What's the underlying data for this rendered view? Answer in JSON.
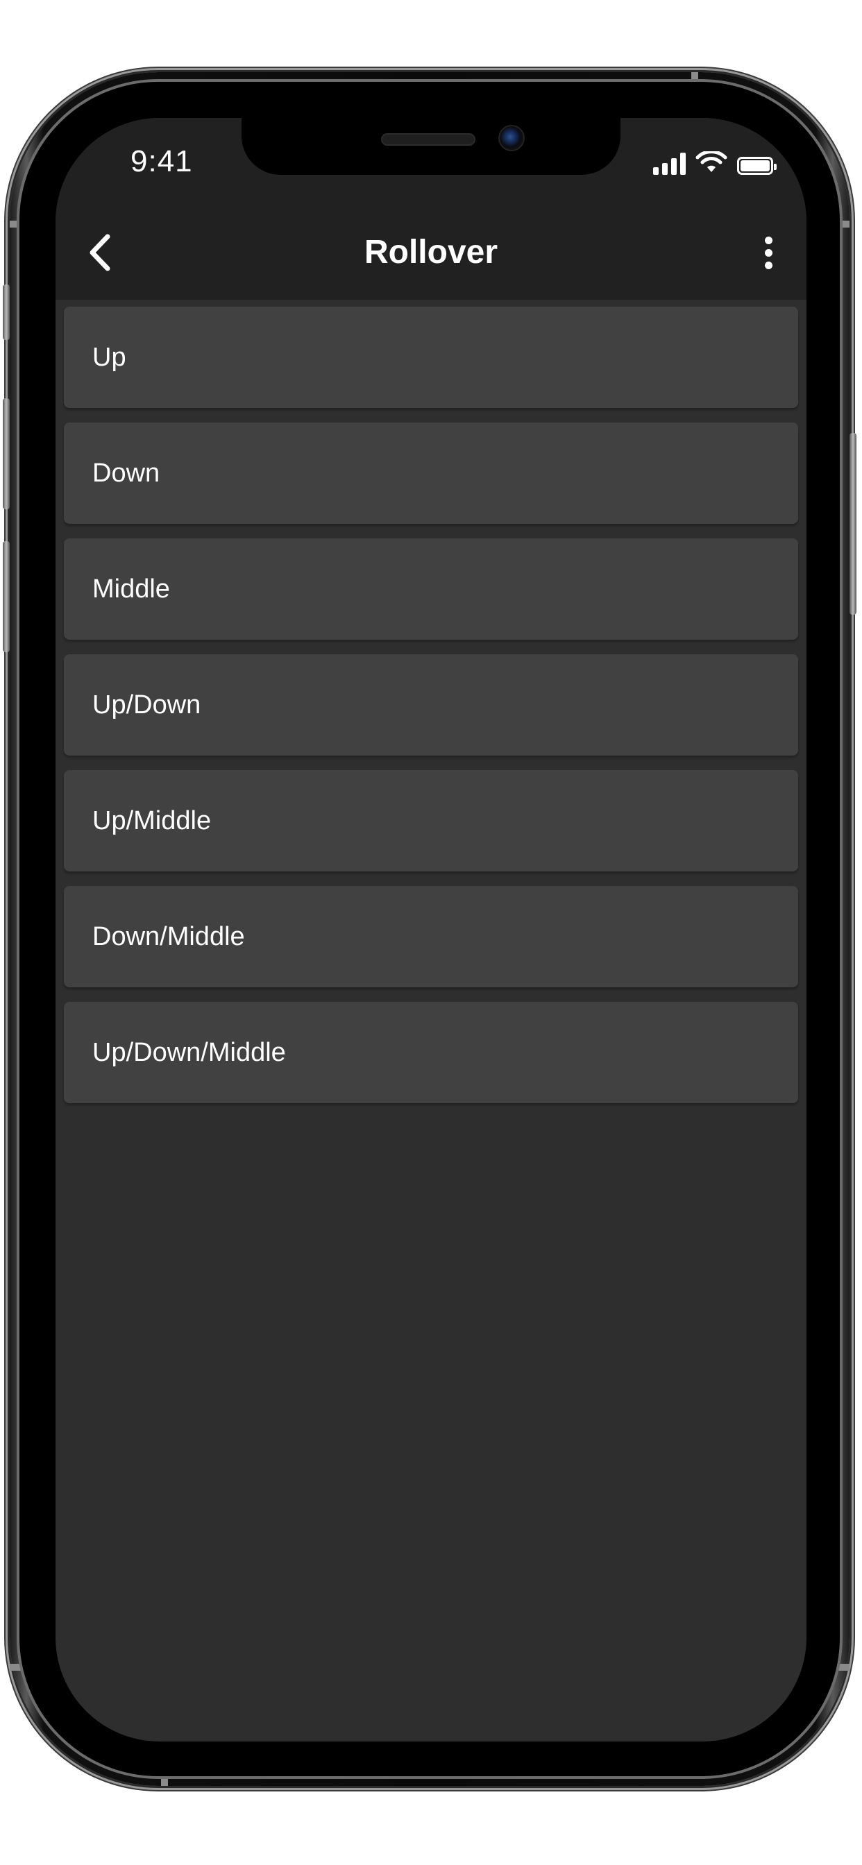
{
  "status_bar": {
    "time": "9:41"
  },
  "app_bar": {
    "title": "Rollover",
    "back_icon": "chevron-left-icon",
    "menu_icon": "more-vertical-icon"
  },
  "options": [
    {
      "label": "Up"
    },
    {
      "label": "Down"
    },
    {
      "label": "Middle"
    },
    {
      "label": "Up/Down"
    },
    {
      "label": "Up/Middle"
    },
    {
      "label": "Down/Middle"
    },
    {
      "label": "Up/Down/Middle"
    }
  ],
  "colors": {
    "background": "#2e2e2e",
    "bar": "#212121",
    "item": "#414141",
    "text": "#ffffff"
  }
}
